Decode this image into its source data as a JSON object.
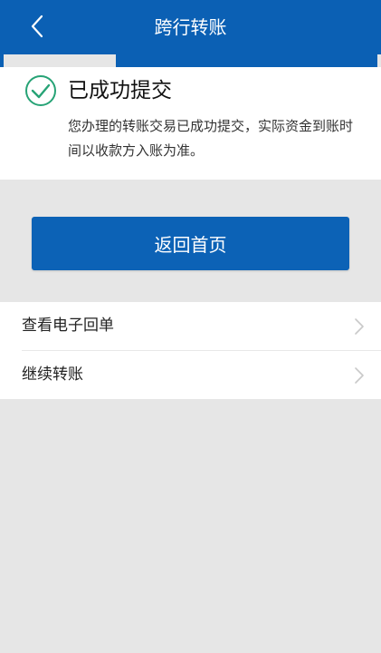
{
  "header": {
    "title": "跨行转账",
    "back_icon": "chevron-left-icon",
    "bg_color": "#0b60b4"
  },
  "result": {
    "icon": "check-circle-icon",
    "icon_color": "#27a376",
    "title": "已成功提交",
    "description": "您办理的转账交易已成功提交，实际资金到账时间以收款方入账为准。"
  },
  "actions": {
    "home_button_label": "返回首页",
    "button_color": "#0c62b6"
  },
  "menu": {
    "items": [
      {
        "label": "查看电子回单",
        "icon": "chevron-right-icon"
      },
      {
        "label": "继续转账",
        "icon": "chevron-right-icon"
      }
    ]
  }
}
